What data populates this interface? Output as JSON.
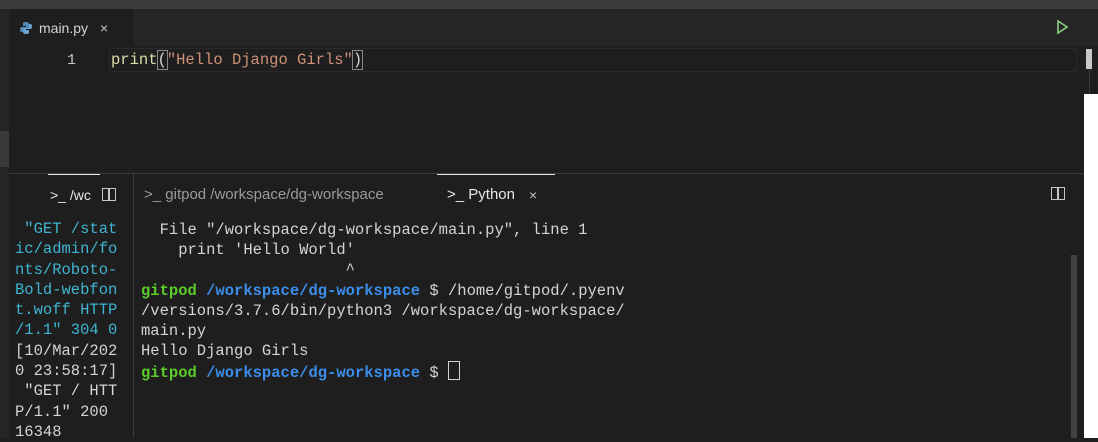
{
  "editor": {
    "tab": {
      "filename": "main.py",
      "close": "×"
    },
    "line_number": "1",
    "code": {
      "fn": "print",
      "open": "(",
      "string": "\"Hello Django Girls\"",
      "close": ")"
    }
  },
  "terminal_left": {
    "tab_label": ">_ /wc",
    "log_lines": [
      {
        "text": " \"GET /stat",
        "color": "#3fb5d1"
      },
      {
        "text": "ic/admin/fo",
        "color": "#3fb5d1"
      },
      {
        "text": "nts/Roboto-",
        "color": "#3fb5d1"
      },
      {
        "text": "Bold-webfon",
        "color": "#3fb5d1"
      },
      {
        "text": "t.woff HTTP",
        "color": "#3fb5d1"
      },
      {
        "text": "/1.1\" 304 0",
        "color": "#3fb5d1"
      },
      {
        "text": "[10/Mar/202",
        "color": "#d4d4d4"
      },
      {
        "text": "0 23:58:17]",
        "color": "#d4d4d4"
      },
      {
        "text": " \"GET / HTT",
        "color": "#d4d4d4"
      },
      {
        "text": "P/1.1\" 200",
        "color": "#d4d4d4"
      },
      {
        "text": "16348",
        "color": "#d4d4d4"
      }
    ]
  },
  "terminal_right": {
    "tab_gitpod": ">_ gitpod /workspace/dg-workspace",
    "tab_python": ">_ Python",
    "tab_python_close": "×",
    "lines": {
      "l1": "  File \"/workspace/dg-workspace/main.py\", line 1",
      "l2": "    print 'Hello World'",
      "l3": "                      ^",
      "prompt_user": "gitpod",
      "prompt_path": "/workspace/dg-workspace",
      "prompt_sym": " $ ",
      "cmd": "/home/gitpod/.pyenv",
      "l5": "/versions/3.7.6/bin/python3 /workspace/dg-workspace/",
      "l6": "main.py",
      "l7": "Hello Django Girls"
    }
  },
  "colors": {
    "accent_green": "#5ccc2a",
    "path_blue": "#3b8eea",
    "log_cyan": "#3fb5d1"
  },
  "icons": [
    "python-file-icon",
    "run-icon",
    "split-terminal-icon"
  ]
}
